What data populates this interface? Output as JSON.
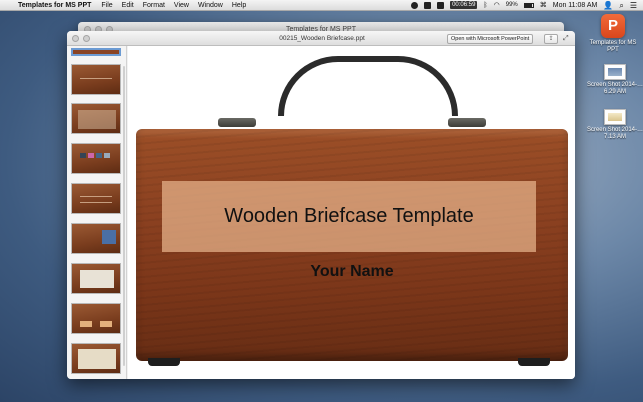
{
  "menubar": {
    "app_name": "Templates for MS PPT",
    "menus": [
      "File",
      "Edit",
      "Format",
      "View",
      "Window",
      "Help"
    ],
    "timer": "00:06:59",
    "battery": "99%",
    "clock": "Mon 11:08 AM"
  },
  "background_window": {
    "title": "Templates for MS PPT"
  },
  "quicklook": {
    "title": "00215_Wooden Briefcase.ppt",
    "open_button": "Open with Microsoft PowerPoint"
  },
  "slide": {
    "title": "Wooden Briefcase Template",
    "subtitle": "Your Name"
  },
  "desktop": {
    "app_icon_label": "Templates for MS PPT",
    "app_icon_letter": "P",
    "screenshot1_label": "Screen Shot 2014-…6.29 AM",
    "screenshot2_label": "Screen Shot 2014-…7.13 AM"
  },
  "icons": [
    "apple-icon",
    "search-icon",
    "list-icon",
    "bluetooth-icon",
    "wifi-icon",
    "user-icon"
  ]
}
